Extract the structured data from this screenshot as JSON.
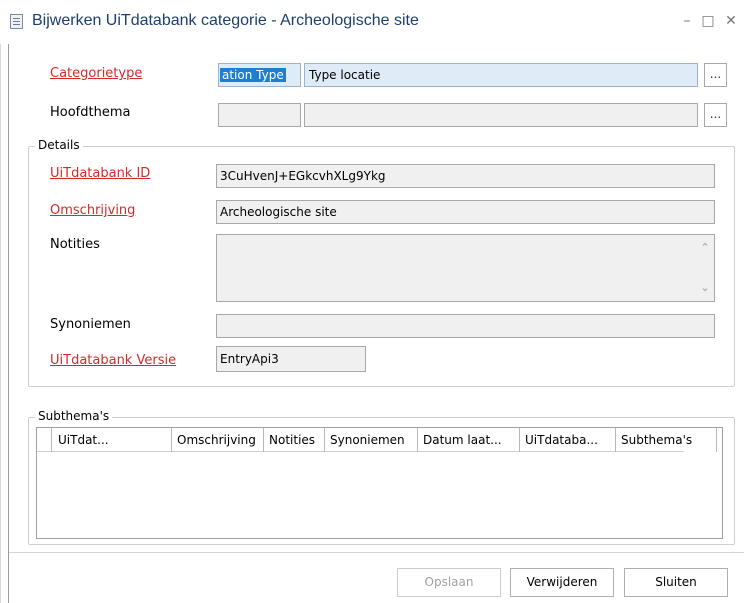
{
  "window": {
    "title": "Bijwerken UiTdatabank categorie - Archeologische site",
    "minimize": "–",
    "maximize": "□",
    "close": "✕"
  },
  "form": {
    "categorietype": {
      "label": "Categorietype",
      "code": "ation Type",
      "value": "Type locatie",
      "button": "..."
    },
    "hoofdthema": {
      "label": "Hoofdthema",
      "code": "",
      "value": "",
      "button": "..."
    },
    "details": {
      "title": "Details",
      "uitdatabank_id": {
        "label": "UiTdatabank ID",
        "value": "3CuHvenJ+EGkcvhXLg9Ykg"
      },
      "omschrijving": {
        "label": "Omschrijving",
        "value": "Archeologische site"
      },
      "notities": {
        "label": "Notities",
        "value": ""
      },
      "synoniemen": {
        "label": "Synoniemen",
        "value": ""
      },
      "versie": {
        "label": "UiTdatabank Versie",
        "value": "EntryApi3"
      }
    }
  },
  "subthemas": {
    "title": "Subthema's",
    "columns": [
      "UiTdat...",
      "Omschrijving",
      "Notities",
      "Synoniemen",
      "Datum laat...",
      "UiTdataba...",
      "Subthema's"
    ]
  },
  "buttons": {
    "opslaan": "Opslaan",
    "verwijderen": "Verwijderen",
    "sluiten": "Sluiten"
  },
  "colors": {
    "title": "#1c3f6e",
    "required_label": "#d42a2a",
    "selection": "#1e7fd1",
    "field_bg": "#f0f0f0",
    "field_active_bg": "#dfecf7"
  }
}
